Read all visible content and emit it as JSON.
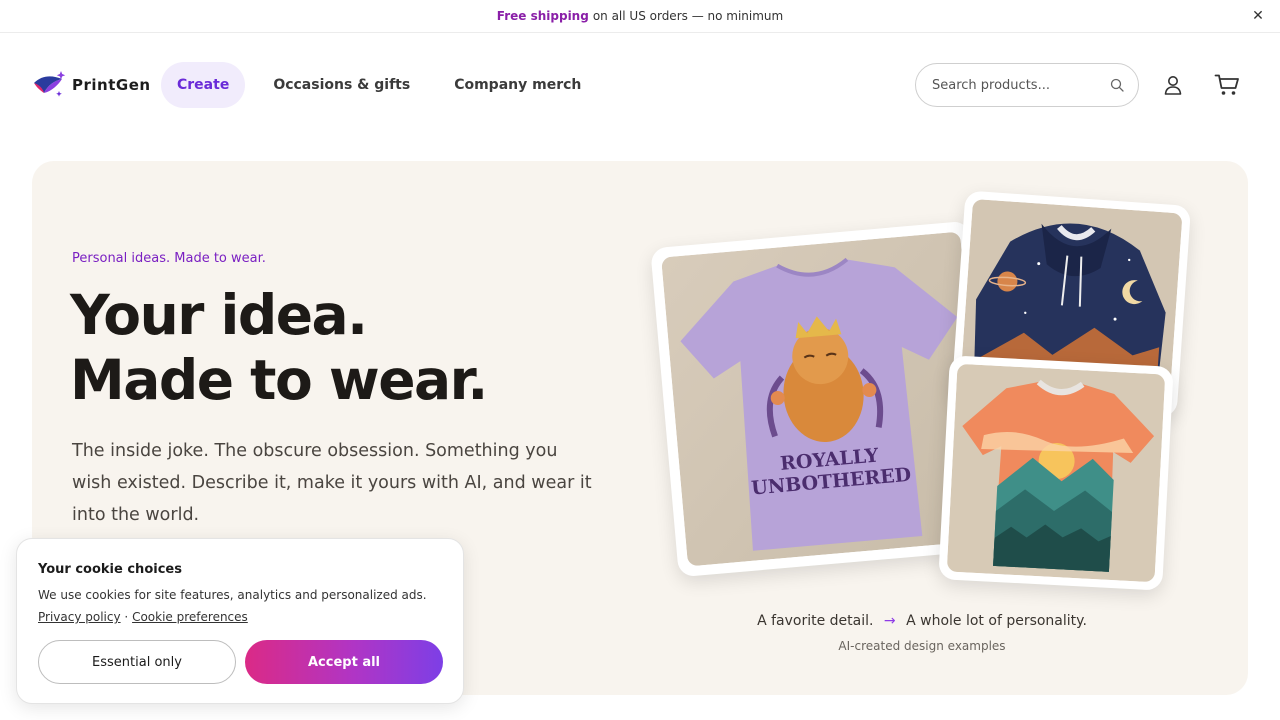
{
  "promo": {
    "highlight": "Free shipping",
    "text": "on all US orders — no minimum",
    "close_icon": "close-icon"
  },
  "header": {
    "brand": "PrintGen",
    "nav": [
      {
        "label": "Create",
        "active": true
      },
      {
        "label": "Occasions & gifts",
        "active": false
      },
      {
        "label": "Company merch",
        "active": false
      }
    ],
    "search": {
      "placeholder": "Search products..."
    },
    "icons": [
      "search-icon",
      "account-icon",
      "cart-icon"
    ]
  },
  "hero": {
    "eyebrow": "Personal ideas. Made to wear.",
    "headline_line1": "Your idea.",
    "headline_line2": "Made to wear.",
    "body": "The inside joke. The obscure obsession. Something you wish existed. Describe it, make it yours with AI, and wear it into the world.",
    "shirt_print_line1": "ROYALLY",
    "shirt_print_line2": "UNBOTHERED",
    "caption_left": "A favorite detail.",
    "caption_arrow": "→",
    "caption_right": "A whole lot of personality.",
    "subcaption": "AI-created design examples"
  },
  "cookie": {
    "title": "Your cookie choices",
    "text": "We use cookies for site features, analytics and personalized ads.",
    "privacy_link": "Privacy policy",
    "separator": "·",
    "preferences_link": "Cookie preferences",
    "essential_button": "Essential only",
    "accept_button": "Accept all"
  },
  "colors": {
    "accent_purple": "#7a1fc2",
    "nav_active_bg": "#f1ecfc",
    "hero_bg": "#f8f4ee",
    "accept_gradient_start": "#db2a86",
    "accept_gradient_end": "#7d3fe6"
  }
}
